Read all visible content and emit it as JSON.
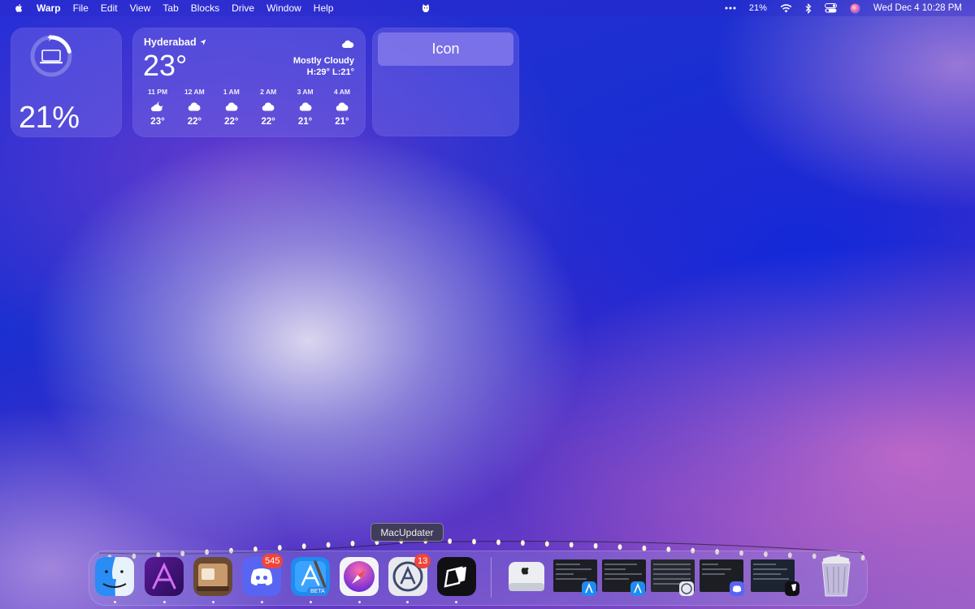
{
  "menubar": {
    "apple_icon": "apple-logo-icon",
    "items": [
      "Warp",
      "File",
      "Edit",
      "View",
      "Tab",
      "Blocks",
      "Drive",
      "Window",
      "Help"
    ],
    "center_icon": "cat-menubar-icon",
    "status": {
      "more_icon": "ellipsis-icon",
      "battery": "21%",
      "wifi_icon": "wifi-icon",
      "bluetooth_icon": "bluetooth-icon",
      "control_center_icon": "control-center-icon",
      "siri_icon": "siri-icon",
      "clock": "Wed Dec 4  10:28 PM"
    }
  },
  "widgets": {
    "battery": {
      "percent": "21%",
      "level": 0.21,
      "device_icon": "laptop-icon",
      "charging_icon": "bolt-icon"
    },
    "weather": {
      "city": "Hyderabad",
      "location_icon": "location-arrow-icon",
      "temperature": "23°",
      "condition": "Mostly Cloudy",
      "condition_icon": "cloud-icon",
      "hi_lo": "H:29° L:21°",
      "hourly": [
        {
          "time": "11 PM",
          "icon": "cloud-moon-icon",
          "temp": "23°"
        },
        {
          "time": "12 AM",
          "icon": "cloud-icon",
          "temp": "22°"
        },
        {
          "time": "1 AM",
          "icon": "cloud-icon",
          "temp": "22°"
        },
        {
          "time": "2 AM",
          "icon": "cloud-icon",
          "temp": "22°"
        },
        {
          "time": "3 AM",
          "icon": "cloud-icon",
          "temp": "21°"
        },
        {
          "time": "4 AM",
          "icon": "cloud-icon",
          "temp": "21°"
        }
      ]
    },
    "icon_widget": {
      "button_label": "Icon"
    }
  },
  "tooltip": {
    "text": "MacUpdater"
  },
  "dock": {
    "apps": [
      {
        "name": "Finder",
        "icon": "finder-icon",
        "running": true
      },
      {
        "name": "Affinity",
        "icon": "affinity-icon",
        "running": true
      },
      {
        "name": "Shelf",
        "icon": "shelf-app-icon",
        "running": true
      },
      {
        "name": "Discord",
        "icon": "discord-icon",
        "running": true,
        "badge": "545"
      },
      {
        "name": "Xcode",
        "icon": "xcode-beta-icon",
        "running": true,
        "label": "BETA"
      },
      {
        "name": "Safari",
        "icon": "safari-icon",
        "running": true
      },
      {
        "name": "MacUpdater",
        "icon": "macupdater-icon",
        "running": true,
        "badge": "13"
      },
      {
        "name": "Warp",
        "icon": "warp-icon",
        "running": true
      }
    ],
    "minimized": [
      {
        "icon": "mac-mini-icon"
      },
      {
        "icon": "window-thumbnail-xcode"
      },
      {
        "icon": "window-thumbnail-xcode-2"
      },
      {
        "icon": "window-thumbnail-macupdater"
      },
      {
        "icon": "window-thumbnail-discord"
      },
      {
        "icon": "window-thumbnail-warp"
      }
    ],
    "trash_icon": "trash-full-icon"
  },
  "colors": {
    "badge": "#f0443a",
    "widget_bg": "#7a6ee6",
    "icon_button": "#8278eb"
  }
}
